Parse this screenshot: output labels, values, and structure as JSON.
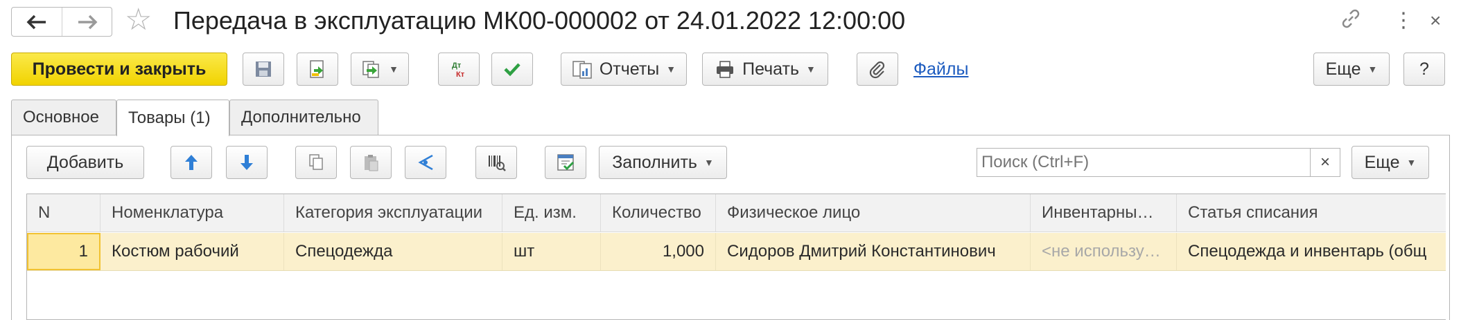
{
  "window": {
    "title": "Передача в эксплуатацию МК00-000002 от 24.01.2022 12:00:00"
  },
  "nav": {
    "back_icon": "arrow-left-icon",
    "forward_icon": "arrow-right-icon"
  },
  "toolbar": {
    "post_close_label": "Провести и закрыть",
    "reports_label": "Отчеты",
    "print_label": "Печать",
    "files_label": "Файлы",
    "more_label": "Еще",
    "help_label": "?"
  },
  "tabs": [
    {
      "label": "Основное",
      "active": false
    },
    {
      "label": "Товары (1)",
      "active": true
    },
    {
      "label": "Дополнительно",
      "active": false
    }
  ],
  "goods": {
    "add_label": "Добавить",
    "fill_label": "Заполнить",
    "search_placeholder": "Поиск (Ctrl+F)",
    "more_label": "Еще",
    "columns": [
      "N",
      "Номенклатура",
      "Категория эксплуатации",
      "Ед. изм.",
      "Количество",
      "Физическое лицо",
      "Инвентарны…",
      "Статья списания"
    ],
    "rows": [
      {
        "n": "1",
        "item": "Костюм рабочий",
        "category": "Спецодежда",
        "unit": "шт",
        "quantity": "1,000",
        "person": "Сидоров Дмитрий Константинович",
        "inventory": "<не использу…",
        "writeoff": "Спецодежда и инвентарь (общ"
      }
    ]
  },
  "colors": {
    "primary_button": "#f1d300",
    "selected_row": "#fbf0cc",
    "link": "#1c5bbf"
  }
}
